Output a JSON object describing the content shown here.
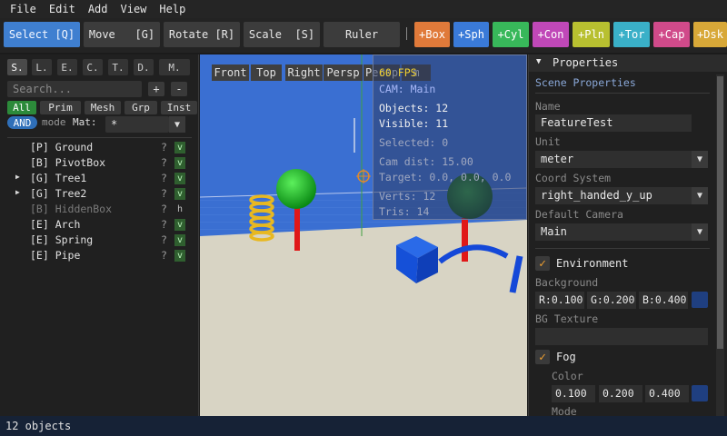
{
  "menubar": {
    "items": [
      "File",
      "Edit",
      "Add",
      "View",
      "Help"
    ]
  },
  "toolbar": {
    "tools": [
      {
        "label": "Select [Q]",
        "active": true
      },
      {
        "label": "Move   [G]",
        "active": false
      },
      {
        "label": "Rotate [R]",
        "active": false
      },
      {
        "label": "Scale  [S]",
        "active": false
      },
      {
        "label": "Ruler",
        "active": false
      }
    ],
    "add_buttons": [
      {
        "label": "+Box",
        "color": "#e07a3a"
      },
      {
        "label": "+Sph",
        "color": "#3a7ad8"
      },
      {
        "label": "+Cyl",
        "color": "#38b85a"
      },
      {
        "label": "+Con",
        "color": "#c048b8"
      },
      {
        "label": "+Pln",
        "color": "#b8c030"
      },
      {
        "label": "+Tor",
        "color": "#3ab0c8"
      },
      {
        "label": "+Cap",
        "color": "#d04a8a"
      },
      {
        "label": "+Dsk",
        "color": "#d8a838"
      }
    ]
  },
  "left_panel": {
    "tabs": [
      "S.",
      "L.",
      "E.",
      "C.",
      "T.",
      "D.",
      "M."
    ],
    "search_placeholder": "Search...",
    "plus": "+",
    "minus": "-",
    "filters": [
      "All",
      "Prim",
      "Mesh",
      "Grp",
      "Inst"
    ],
    "and_label": "AND",
    "mode_label": "mode",
    "mat_label": "Mat:",
    "mat_value": "*",
    "tree": [
      {
        "label": "[P] Ground",
        "expandable": false,
        "vis": "v",
        "dim": false
      },
      {
        "label": "[B] PivotBox",
        "expandable": false,
        "vis": "v",
        "dim": false
      },
      {
        "label": "[G] Tree1",
        "expandable": true,
        "vis": "v",
        "dim": false
      },
      {
        "label": "[G] Tree2",
        "expandable": true,
        "vis": "v",
        "dim": false
      },
      {
        "label": "[B] HiddenBox",
        "expandable": false,
        "vis": "h",
        "dim": true
      },
      {
        "label": "[E] Arch",
        "expandable": false,
        "vis": "v",
        "dim": false
      },
      {
        "label": "[E] Spring",
        "expandable": false,
        "vis": "v",
        "dim": false
      },
      {
        "label": "[E] Pipe",
        "expandable": false,
        "vis": "v",
        "dim": false
      }
    ],
    "q_mark": "?"
  },
  "viewport": {
    "tabs": [
      "Front",
      "Top",
      "Right",
      "Persp",
      "Persp"
    ],
    "tab_tail": "m",
    "overlay": {
      "fps": "60 FPS",
      "cam": "CAM: Main",
      "objects": "Objects: 12",
      "visible": "Visible: 11",
      "selected": "Selected: 0",
      "cam_dist": "Cam dist: 15.00",
      "target": "Target: 0.0, 0.0, 0.0",
      "verts": "Verts: 12",
      "tris": "Tris: 14"
    }
  },
  "properties": {
    "header": "Properties",
    "section": "Scene Properties",
    "name_label": "Name",
    "name_value": "FeatureTest",
    "unit_label": "Unit",
    "unit_value": "meter",
    "coord_label": "Coord System",
    "coord_value": "right_handed_y_up",
    "camera_label": "Default Camera",
    "camera_value": "Main",
    "environment_label": "Environment",
    "background_label": "Background",
    "bg_r": "R:0.100",
    "bg_g": "G:0.200",
    "bg_b": "B:0.400",
    "bgtex_label": "BG Texture",
    "fog_label": "Fog",
    "color_label": "Color",
    "fog_r": "0.100",
    "fog_g": "0.200",
    "fog_b": "0.400",
    "mode_label": "Mode",
    "check_glyph": "✓",
    "swatch_color": "#1f3f80"
  },
  "statusbar": {
    "text": "12 objects"
  }
}
